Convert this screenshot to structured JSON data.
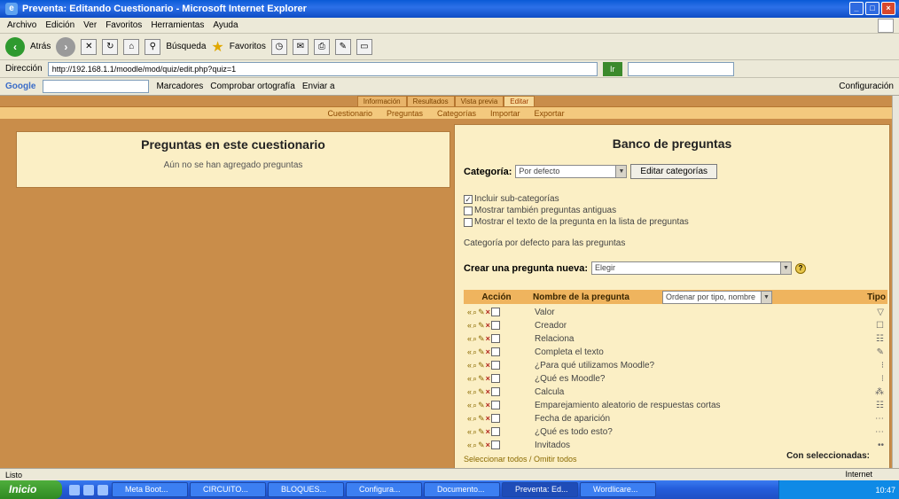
{
  "window": {
    "title": "Preventa: Editando Cuestionario - Microsoft Internet Explorer"
  },
  "menu": {
    "items": [
      "Archivo",
      "Edición",
      "Ver",
      "Favoritos",
      "Herramientas",
      "Ayuda"
    ]
  },
  "toolbar": {
    "back_label": "Atrás",
    "search_label": "Búsqueda",
    "favorites_label": "Favoritos"
  },
  "address": {
    "label": "Dirección",
    "url": "http://192.168.1.1/moodle/mod/quiz/edit.php?quiz=1",
    "go_label": "Ir"
  },
  "google": {
    "logo": "Google",
    "settings_label": "Configuración",
    "bookmarks_label": "Marcadores",
    "check_label": "Comprobar ortografía",
    "send_label": "Enviar a"
  },
  "page": {
    "tabs_primary": [
      "Información",
      "Resultados",
      "Vista previa",
      "Editar"
    ],
    "tabs_secondary": [
      "Cuestionario",
      "Preguntas",
      "Categorías",
      "Importar",
      "Exportar"
    ],
    "left": {
      "title": "Preguntas en este cuestionario",
      "message": "Aún no se han agregado preguntas"
    },
    "right": {
      "title": "Banco de preguntas",
      "category_label": "Categoría:",
      "category_value": "Por defecto",
      "edit_categories": "Editar categorías",
      "checks": [
        {
          "label": "Incluir sub-categorías",
          "checked": true
        },
        {
          "label": "Mostrar también preguntas antiguas",
          "checked": false
        },
        {
          "label": "Mostrar el texto de la pregunta en la lista de preguntas",
          "checked": false
        }
      ],
      "default_text": "Categoría por defecto para las preguntas",
      "create_label": "Crear una pregunta nueva:",
      "create_value": "Elegir",
      "head_action": "Acción",
      "head_name": "Nombre de la pregunta",
      "sort_value": "Ordenar por tipo, nombre",
      "head_type": "Tipo",
      "questions": [
        {
          "name": "Valor",
          "type": "▽"
        },
        {
          "name": "Creador",
          "type": "☐"
        },
        {
          "name": "Relaciona",
          "type": "☷"
        },
        {
          "name": "Completa el texto",
          "type": "✎"
        },
        {
          "name": "¿Para qué utilizamos Moodle?",
          "type": "⁝"
        },
        {
          "name": "¿Qué es Moodle?",
          "type": "⁝"
        },
        {
          "name": "Calcula",
          "type": "⁂"
        },
        {
          "name": "Emparejamiento aleatorio de respuestas cortas",
          "type": "☷"
        },
        {
          "name": "Fecha de aparición",
          "type": "⋯"
        },
        {
          "name": "¿Qué es todo esto?",
          "type": "⋯"
        },
        {
          "name": "Invitados",
          "type": "••"
        }
      ],
      "select_all": "Seleccionar todos / Omitir todos",
      "with_selected": "Con seleccionadas:"
    }
  },
  "status": {
    "left": "Listo",
    "zone": "Internet"
  },
  "taskbar": {
    "start": "Inicio",
    "tasks": [
      "Meta Boot...",
      "CIRCUITO...",
      "BLOQUES...",
      "Configura...",
      "Documento...",
      "Preventa: Ed...",
      "Wordlicare..."
    ],
    "clock": "10:47"
  }
}
